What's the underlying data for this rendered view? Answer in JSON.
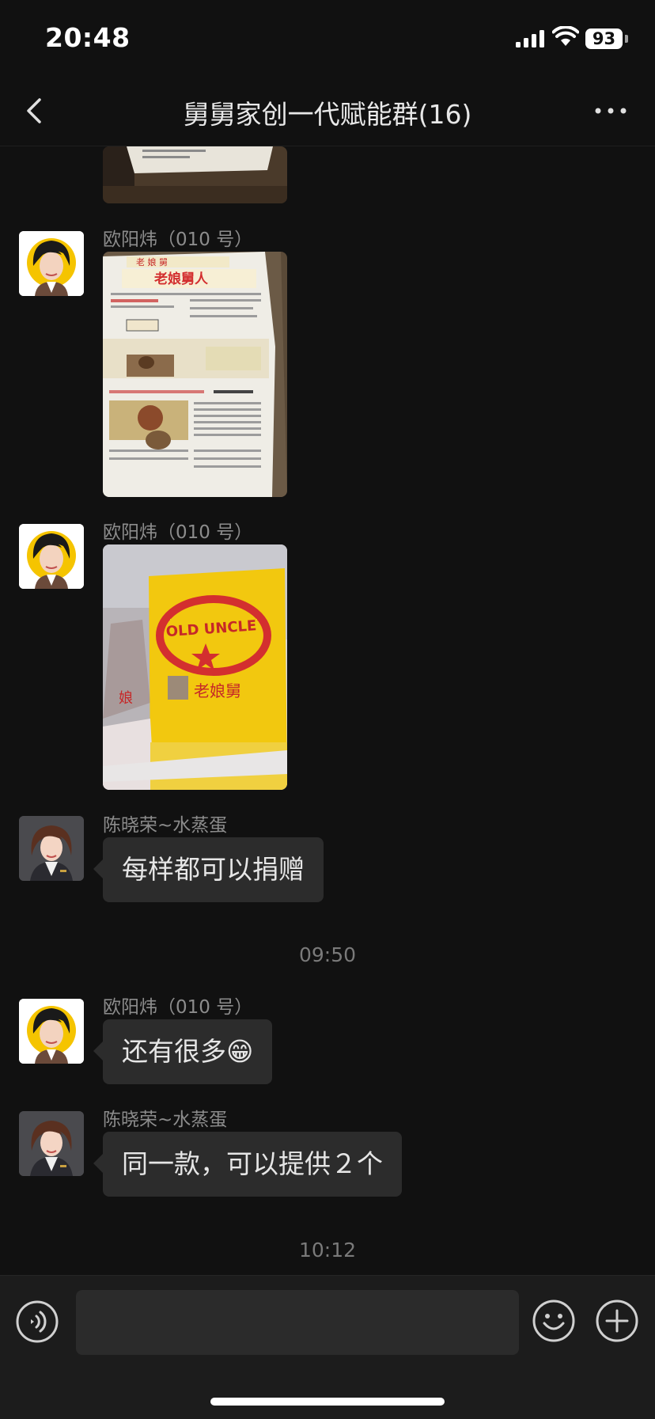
{
  "status_bar": {
    "time": "20:48",
    "battery": "93"
  },
  "header": {
    "title": "舅舅家创一代赋能群(16)"
  },
  "messages": [
    {
      "type": "image",
      "caption": "partially visible photo of printed document"
    },
    {
      "type": "image",
      "sender": "欧阳炜（010 号）",
      "caption": "newspaper-style printed leaflet, red headline"
    },
    {
      "type": "image",
      "sender": "欧阳炜（010 号）",
      "caption": "yellow and red OLD UNCLE packaging bag"
    },
    {
      "type": "text",
      "sender": "陈晓荣~水蒸蛋",
      "text": "每样都可以捐赠"
    },
    {
      "type": "time",
      "text": "09:50"
    },
    {
      "type": "text",
      "sender": "欧阳炜（010 号）",
      "text": "还有很多😁"
    },
    {
      "type": "text",
      "sender": "陈晓荣~水蒸蛋",
      "text": "同一款，可以提供２个"
    },
    {
      "type": "time",
      "text": "10:12"
    }
  ],
  "icons": {
    "back": "chevron-left-icon",
    "more": "more-dots-icon",
    "voice": "voice-icon",
    "emoji": "emoji-icon",
    "plus": "plus-icon"
  },
  "colors": {
    "background": "#111111",
    "bubble": "#2c2c2c",
    "input_bar": "#1c1c1c"
  }
}
